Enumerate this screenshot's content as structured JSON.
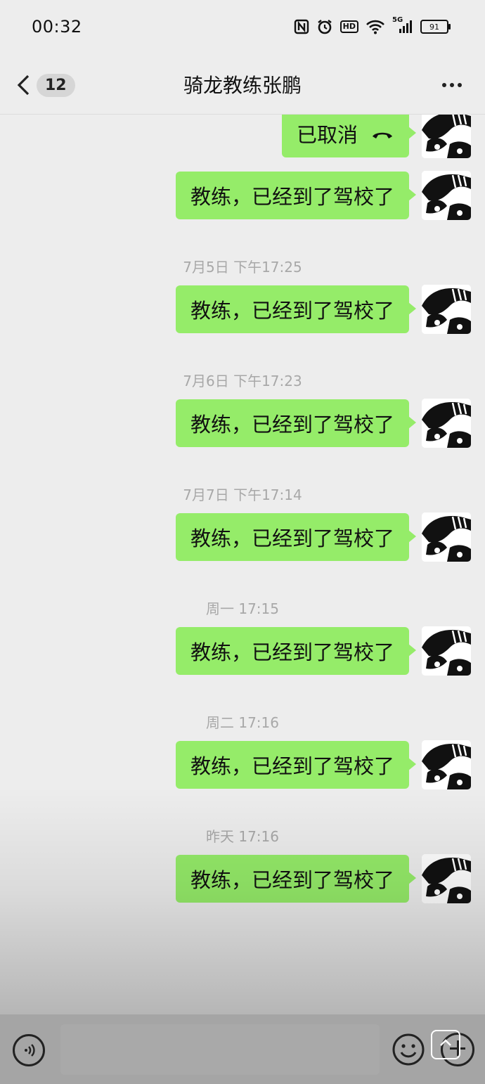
{
  "status": {
    "time": "00:32",
    "icons": [
      "nfc-icon",
      "alarm-icon",
      "hd-icon",
      "wifi-icon",
      "signal-5g-icon",
      "battery-icon"
    ],
    "hd_label": "HD",
    "network_label": "5G",
    "battery": "91"
  },
  "nav": {
    "unread_count": "12",
    "title": "骑龙教练张鹏",
    "more_icon": "more-dots-icon",
    "back_icon": "chevron-left-icon"
  },
  "messages": [
    {
      "kind": "call",
      "text": "已取消",
      "icon": "phone-hangup-icon",
      "side": "right"
    },
    {
      "kind": "text",
      "text": "教练，已经到了驾校了",
      "side": "right"
    },
    {
      "kind": "timestamp",
      "text": "7月5日 下午17:25"
    },
    {
      "kind": "text",
      "text": "教练，已经到了驾校了",
      "side": "right"
    },
    {
      "kind": "timestamp",
      "text": "7月6日 下午17:23"
    },
    {
      "kind": "text",
      "text": "教练，已经到了驾校了",
      "side": "right"
    },
    {
      "kind": "timestamp",
      "text": "7月7日 下午17:14"
    },
    {
      "kind": "text",
      "text": "教练，已经到了驾校了",
      "side": "right"
    },
    {
      "kind": "timestamp",
      "text": "周一 17:15"
    },
    {
      "kind": "text",
      "text": "教练，已经到了驾校了",
      "side": "right"
    },
    {
      "kind": "timestamp",
      "text": "周二 17:16"
    },
    {
      "kind": "text",
      "text": "教练，已经到了驾校了",
      "side": "right"
    },
    {
      "kind": "timestamp",
      "text": "昨天 17:16"
    },
    {
      "kind": "text",
      "text": "教练，已经到了驾校了",
      "side": "right"
    }
  ],
  "input_bar": {
    "voice_icon": "voice-icon",
    "emoji_icon": "emoji-icon",
    "plus_icon": "plus-icon",
    "share_icon": "share-icon"
  },
  "colors": {
    "background": "#ededed",
    "bubble": "#95ec69",
    "timestamp": "#a8a8a8"
  }
}
